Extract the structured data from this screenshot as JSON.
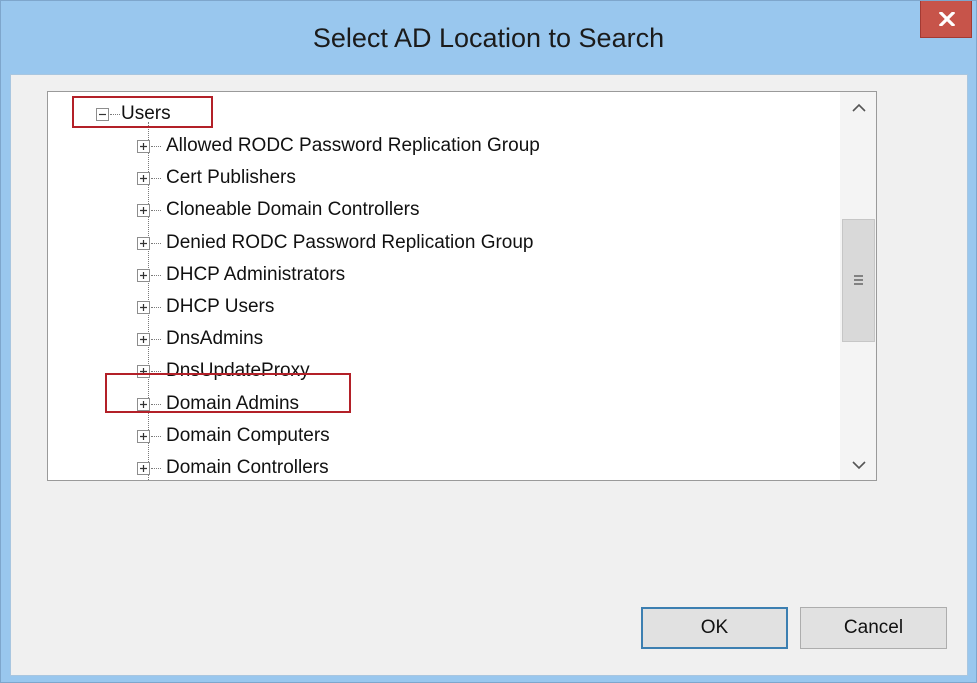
{
  "window": {
    "title": "Select AD Location to Search",
    "close_label": "x"
  },
  "tree": {
    "root": {
      "label": "Users",
      "expander": "minus"
    },
    "children": [
      {
        "label": "Allowed RODC Password Replication Group",
        "expander": "plus"
      },
      {
        "label": "Cert Publishers",
        "expander": "plus"
      },
      {
        "label": "Cloneable Domain Controllers",
        "expander": "plus"
      },
      {
        "label": "Denied RODC Password Replication Group",
        "expander": "plus"
      },
      {
        "label": "DHCP Administrators",
        "expander": "plus"
      },
      {
        "label": "DHCP Users",
        "expander": "plus"
      },
      {
        "label": "DnsAdmins",
        "expander": "plus"
      },
      {
        "label": "DnsUpdateProxy",
        "expander": "plus"
      },
      {
        "label": "Domain Admins",
        "expander": "plus"
      },
      {
        "label": "Domain Computers",
        "expander": "plus"
      },
      {
        "label": "Domain Controllers",
        "expander": "plus"
      }
    ],
    "highlighted": [
      "Users",
      "Domain Admins"
    ]
  },
  "scrollbar": {
    "up_icon": "chevron-up-icon",
    "down_icon": "chevron-down-icon",
    "thumb_icon": "grip-icon"
  },
  "buttons": {
    "ok": "OK",
    "cancel": "Cancel"
  },
  "colors": {
    "title_bar": "#99c7ee",
    "close": "#c7544a",
    "highlight": "#b32028",
    "client": "#f0f0f0"
  }
}
